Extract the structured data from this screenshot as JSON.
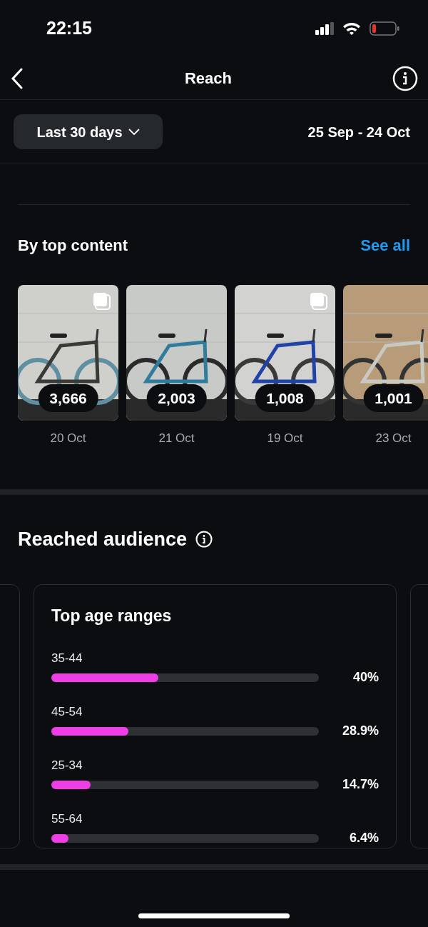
{
  "status_bar": {
    "time": "22:15"
  },
  "header": {
    "title": "Reach"
  },
  "filter": {
    "range": "Last 30 days",
    "dates": "25 Sep - 24 Oct"
  },
  "top_content": {
    "title": "By top content",
    "link": "See all",
    "posts": [
      {
        "count": "3,666",
        "date": "20 Oct",
        "multiple": true
      },
      {
        "count": "2,003",
        "date": "21 Oct",
        "multiple": false
      },
      {
        "count": "1,008",
        "date": "19 Oct",
        "multiple": true
      },
      {
        "count": "1,001",
        "date": "23 Oct",
        "multiple": false
      }
    ]
  },
  "audience": {
    "title": "Reached audience",
    "card": {
      "title": "Top age ranges",
      "rows": [
        {
          "label": "35-44",
          "level": 0.4,
          "value": "40%"
        },
        {
          "label": "45-54",
          "level": 0.289,
          "value": "28.9%"
        },
        {
          "label": "25-34",
          "level": 0.147,
          "value": "14.7%"
        },
        {
          "label": "55-64",
          "level": 0.064,
          "value": "6.4%"
        }
      ]
    }
  }
}
